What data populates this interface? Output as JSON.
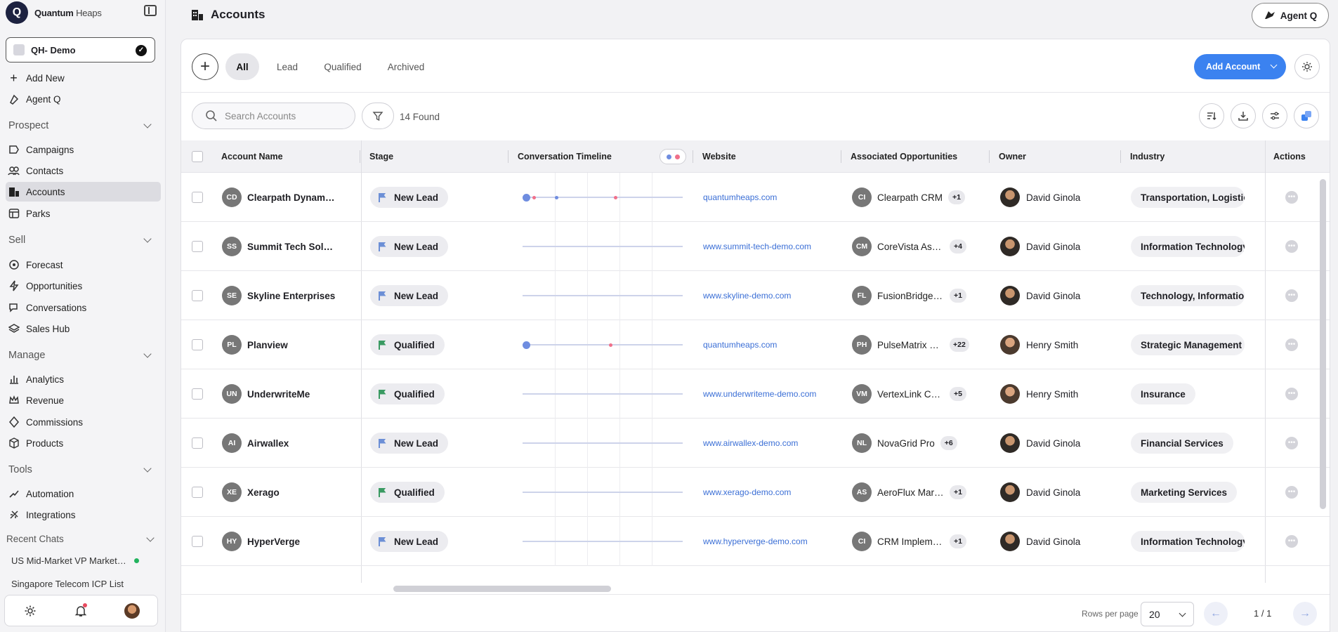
{
  "brand": {
    "name_bold": "Quantum",
    "name_light": " Heaps"
  },
  "workspace": {
    "name": "QH- Demo"
  },
  "quick_actions": [
    {
      "label": "Add New",
      "icon": "plus-icon"
    },
    {
      "label": "Agent Q",
      "icon": "agent-icon"
    }
  ],
  "sections": {
    "prospect": {
      "title": "Prospect",
      "items": [
        "Campaigns",
        "Contacts",
        "Accounts",
        "Parks"
      ]
    },
    "sell": {
      "title": "Sell",
      "items": [
        "Forecast",
        "Opportunities",
        "Conversations",
        "Sales Hub"
      ]
    },
    "manage": {
      "title": "Manage",
      "items": [
        "Analytics",
        "Revenue",
        "Commissions",
        "Products"
      ]
    },
    "tools": {
      "title": "Tools",
      "items": [
        "Automation",
        "Integrations"
      ]
    }
  },
  "recent_chats": {
    "title": "Recent Chats",
    "items": [
      "US Mid-Market VP Marketing",
      "Singapore Telecom ICP List"
    ]
  },
  "header": {
    "title": "Accounts",
    "agent_button": "Agent Q"
  },
  "tabs": [
    "All",
    "Lead",
    "Qualified",
    "Archived"
  ],
  "active_tab": "All",
  "add_account_label": "Add Account",
  "search": {
    "placeholder": "Search Accounts",
    "value": ""
  },
  "found_count": "14 Found",
  "columns": [
    "Account Name",
    "Stage",
    "Conversation Timeline",
    "Website",
    "Associated Opportunities",
    "Owner",
    "Industry",
    "Actions"
  ],
  "colors": {
    "accent": "#3b82f0",
    "timeline_blue": "#6f8de0",
    "timeline_red": "#f0708a"
  },
  "rows": [
    {
      "initials": "CD",
      "name": "Clearpath Dynamics",
      "stage": "New Lead",
      "website": "quantumheaps.com",
      "opp_initials": "CI",
      "opp": "Clearpath CRM",
      "opp_more": "+1",
      "owner": "David Ginola",
      "industry": "Transportation, Logistics"
    },
    {
      "initials": "SS",
      "name": "Summit Tech Solutions",
      "stage": "New Lead",
      "website": "www.summit-tech-demo.com",
      "opp_initials": "CM",
      "opp": "CoreVista Assist",
      "opp_more": "+4",
      "owner": "David Ginola",
      "industry": "Information Technology"
    },
    {
      "initials": "SE",
      "name": "Skyline Enterprises",
      "stage": "New Lead",
      "website": "www.skyline-demo.com",
      "opp_initials": "FL",
      "opp": "FusionBridge Link",
      "opp_more": "+1",
      "owner": "David Ginola",
      "industry": "Technology, Information"
    },
    {
      "initials": "PL",
      "name": "Planview",
      "stage": "Qualified",
      "website": "quantumheaps.com",
      "opp_initials": "PH",
      "opp": "PulseMatrix Hub",
      "opp_more": "+22",
      "owner": "Henry Smith",
      "industry": "Strategic Management"
    },
    {
      "initials": "UN",
      "name": "UnderwriteMe",
      "stage": "Qualified",
      "website": "www.underwriteme-demo.com",
      "opp_initials": "VM",
      "opp": "VertexLink CRM",
      "opp_more": "+5",
      "owner": "Henry Smith",
      "industry": "Insurance"
    },
    {
      "initials": "AI",
      "name": "Airwallex",
      "stage": "New Lead",
      "website": "www.airwallex-demo.com",
      "opp_initials": "NL",
      "opp": "NovaGrid Pro",
      "opp_more": "+6",
      "owner": "David Ginola",
      "industry": "Financial Services"
    },
    {
      "initials": "XE",
      "name": "Xerago",
      "stage": "Qualified",
      "website": "www.xerago-demo.com",
      "opp_initials": "AS",
      "opp": "AeroFlux Market",
      "opp_more": "+1",
      "owner": "David Ginola",
      "industry": "Marketing Services"
    },
    {
      "initials": "HY",
      "name": "HyperVerge",
      "stage": "New Lead",
      "website": "www.hyperverge-demo.com",
      "opp_initials": "CI",
      "opp": "CRM Implementation",
      "opp_more": "+1",
      "owner": "David Ginola",
      "industry": "Information Technology"
    }
  ],
  "pagination": {
    "rows_label": "Rows per page",
    "rows_value": "20",
    "page": "1 / 1"
  }
}
